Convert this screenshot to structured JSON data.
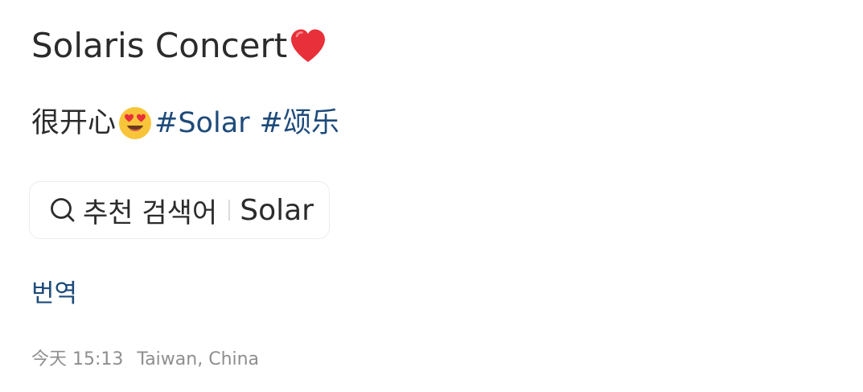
{
  "post": {
    "title": "Solaris Concert",
    "title_emoji": "heart-emoji",
    "body_text": "很开心",
    "body_emoji": "heart-eyes-emoji",
    "hashtags": [
      "#Solar",
      "#颂乐"
    ]
  },
  "search_chip": {
    "icon": "search-icon",
    "label": "추천 검색어",
    "term": "Solar"
  },
  "translate": {
    "label": "번역"
  },
  "meta": {
    "date": "今天 15:13",
    "location": "Taiwan, China"
  },
  "colors": {
    "text": "#2b2b2b",
    "link": "#1e4b7a",
    "muted": "#8e8e8e",
    "heart": "#e8303a",
    "emoji_face": "#f8c53a"
  }
}
